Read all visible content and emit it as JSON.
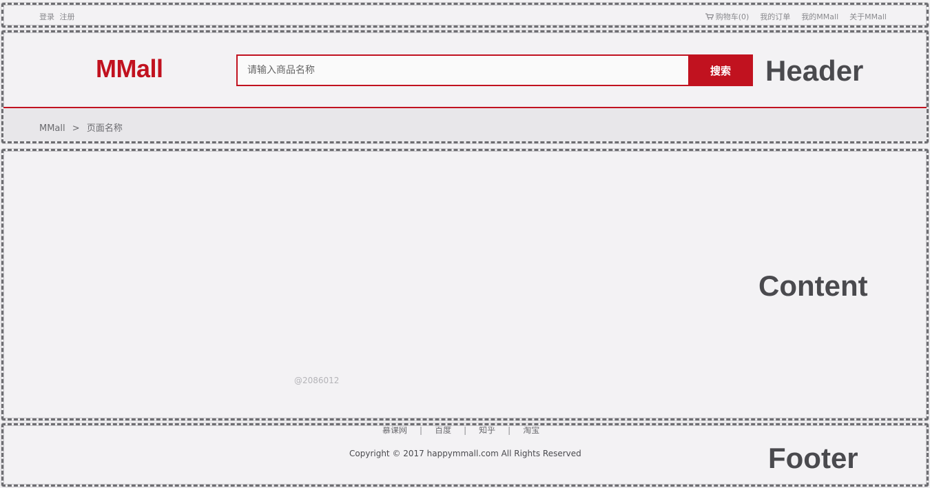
{
  "topbar": {
    "login": "登录",
    "register": "注册",
    "cart": "购物车(0)",
    "my_orders": "我的订单",
    "my_mmall": "我的MMall",
    "about": "关于MMall"
  },
  "header": {
    "logo": "MMall",
    "search_placeholder": "请输入商品名称",
    "search_button": "搜索",
    "section_label": "Header",
    "breadcrumb": {
      "home": "MMall",
      "separator": ">",
      "current": "页面名称"
    }
  },
  "content": {
    "section_label": "Content",
    "watermark": "@2086012"
  },
  "footer": {
    "links": [
      "慕课网",
      "百度",
      "知乎",
      "淘宝"
    ],
    "separator": "|",
    "copyright": "Copyright © 2017 happymmall.com All Rights Reserved",
    "section_label": "Footer"
  },
  "colors": {
    "brand_red": "#c1121f",
    "background": "#f3f2f4",
    "wireframe_border": "#6e6e72"
  }
}
